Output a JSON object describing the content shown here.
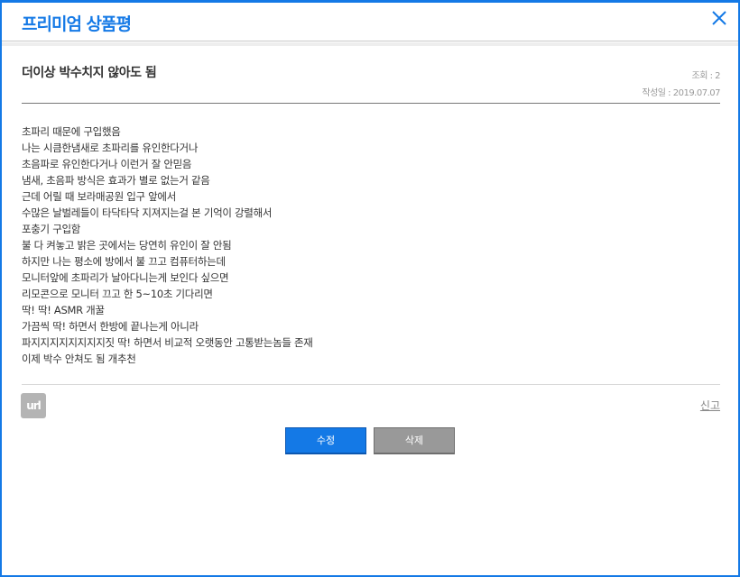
{
  "header": {
    "title": "프리미엄 상품평",
    "close_icon": "close-icon"
  },
  "post": {
    "title": "더이상 박수치지 않아도 됨",
    "views": "조회 : 2",
    "date": "작성일 : 2019.07.07",
    "lines": [
      "초파리 때문에 구입했음",
      "나는 시큼한냄새로 초파리를 유인한다거나",
      "초음파로 유인한다거나 이런거 잘 안믿음",
      "냄새,  초음파 방식은 효과가 별로 없는거 같음",
      "근데 어릴 때 보라매공원 입구 앞에서",
      "수많은 날벌레들이 타닥타닥 지져지는걸 본 기억이 강렬해서",
      "포충기 구입함",
      "불 다 켜놓고 밝은 곳에서는 당연히 유인이 잘 안됨",
      "하지만 나는 평소에 방에서 불 끄고 컴퓨터하는데",
      "모니터앞에 초파리가 날아다니는게 보인다 싶으면",
      "리모콘으로 모니터 끄고 한 5~10초 기다리면",
      "딱! 딱! ASMR 개꿀",
      "가끔씩 딱! 하면서 한방에 끝나는게 아니라",
      "파지지지지지지지지짓 딱! 하면서 비교적 오랫동안 고통받는놈들 존재",
      "이제 박수 안쳐도 됨 개추천"
    ]
  },
  "actions": {
    "url_label": "url",
    "report_label": "신고",
    "edit_label": "수정",
    "delete_label": "삭제"
  },
  "colors": {
    "accent": "#1479e6",
    "delete": "#999999"
  }
}
